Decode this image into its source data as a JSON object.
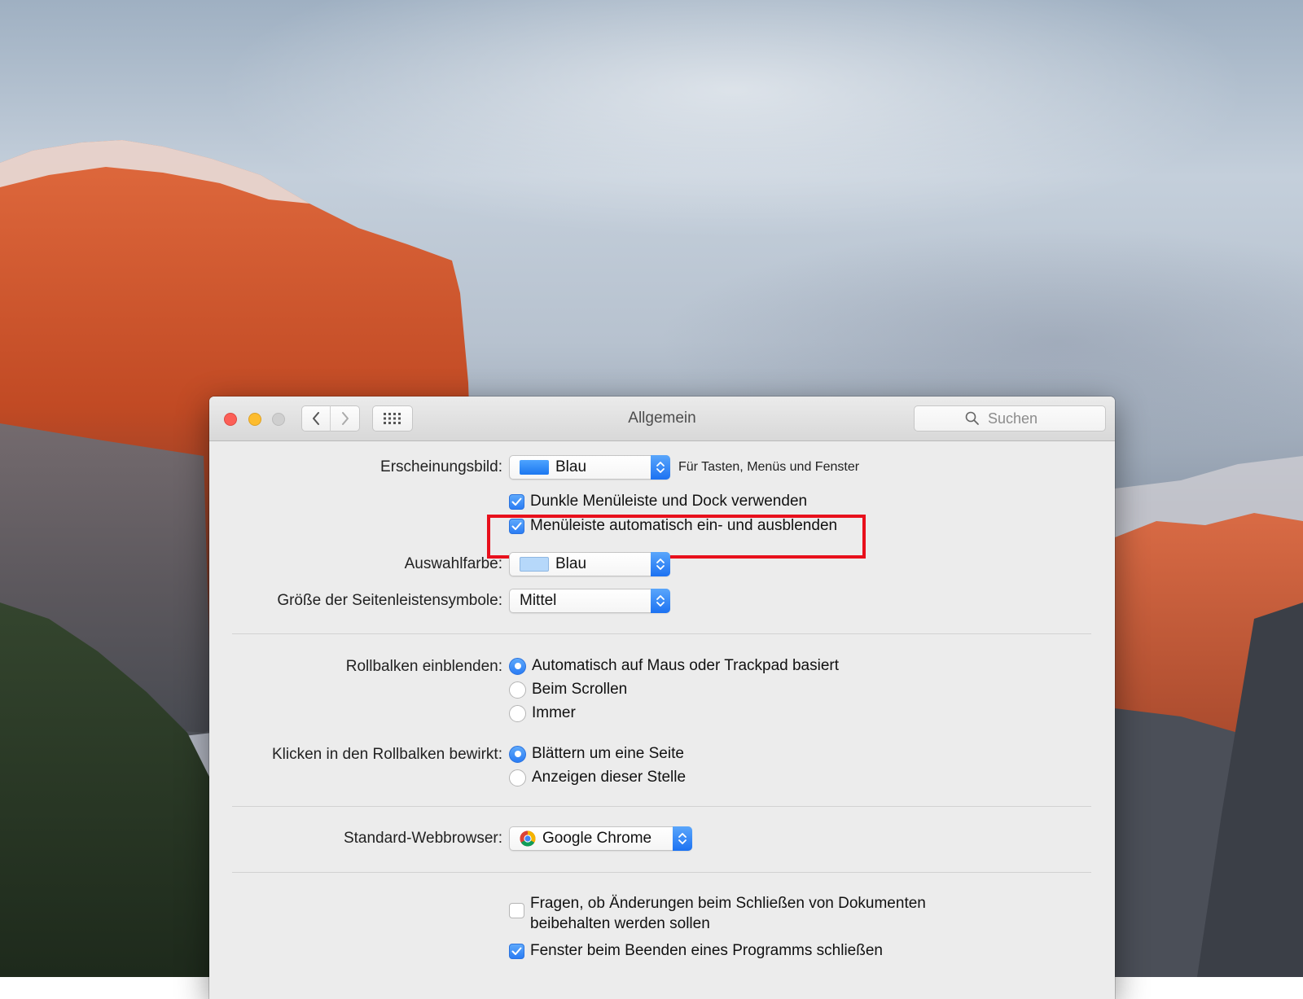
{
  "window": {
    "title": "Allgemein",
    "search_placeholder": "Suchen"
  },
  "appearance": {
    "label": "Erscheinungsbild:",
    "value": "Blau",
    "hint": "Für Tasten, Menüs und Fenster",
    "swatch_color": "#1c78f0",
    "dark_menu_label": "Dunkle Menüleiste und Dock verwenden",
    "dark_menu_checked": true,
    "autohide_label": "Menüleiste automatisch ein- und ausblenden",
    "autohide_checked": true
  },
  "highlight": {
    "label": "Auswahlfarbe:",
    "value": "Blau",
    "swatch_color": "#b6d8fa"
  },
  "sidebar_size": {
    "label": "Größe der Seitenleistensymbole:",
    "value": "Mittel"
  },
  "scrollbars": {
    "label": "Rollbalken einblenden:",
    "options": [
      {
        "label": "Automatisch auf Maus oder Trackpad basiert",
        "selected": true
      },
      {
        "label": "Beim Scrollen",
        "selected": false
      },
      {
        "label": "Immer",
        "selected": false
      }
    ]
  },
  "scroll_click": {
    "label": "Klicken in den Rollbalken bewirkt:",
    "options": [
      {
        "label": "Blättern um eine Seite",
        "selected": true
      },
      {
        "label": "Anzeigen dieser Stelle",
        "selected": false
      }
    ]
  },
  "browser": {
    "label": "Standard-Webbrowser:",
    "value": "Google Chrome"
  },
  "documents": {
    "ask_keep_line1": "Fragen, ob Änderungen beim Schließen von Dokumenten",
    "ask_keep_line2": "beibehalten werden sollen",
    "ask_keep_checked": false,
    "close_windows_label": "Fenster beim Beenden eines Programms schließen",
    "close_windows_checked": true
  },
  "colors": {
    "annotation_red": "#e8101c",
    "accent_blue": "#2a7cf4"
  }
}
